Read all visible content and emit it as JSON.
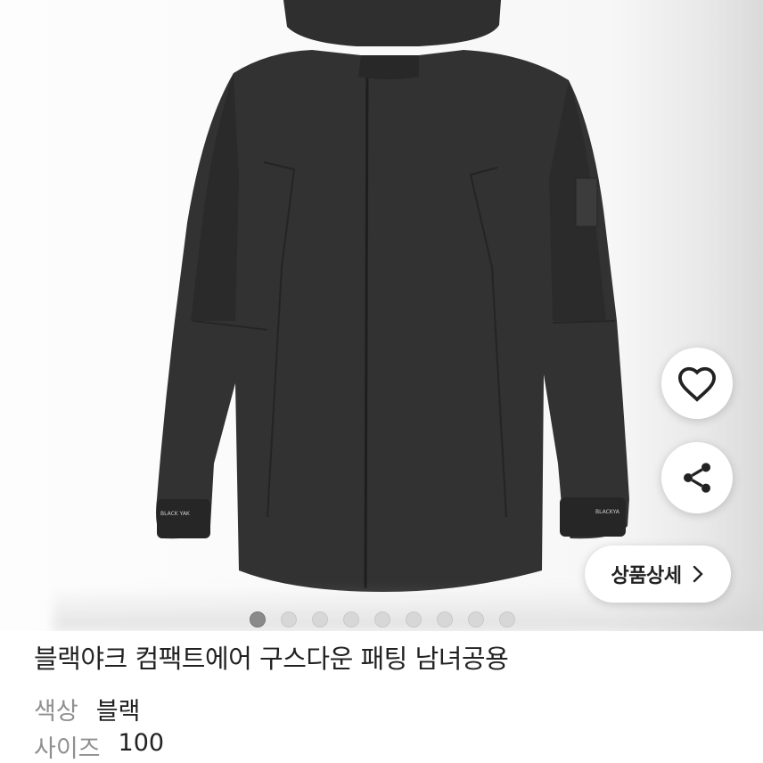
{
  "product": {
    "title": "블랙야크 컴팩트에어 구스다운 패팅 남녀공용",
    "color_label": "색상",
    "color_value": "블랙",
    "size_label": "사이즈",
    "size_value": "100"
  },
  "actions": {
    "like_icon": "heart-icon",
    "share_icon": "share-icon",
    "detail_label": "상품상세"
  },
  "carousel": {
    "total": 9,
    "current": 1
  },
  "image": {
    "logo_left": "BLACK YAK",
    "logo_right": "BLACKYA"
  }
}
